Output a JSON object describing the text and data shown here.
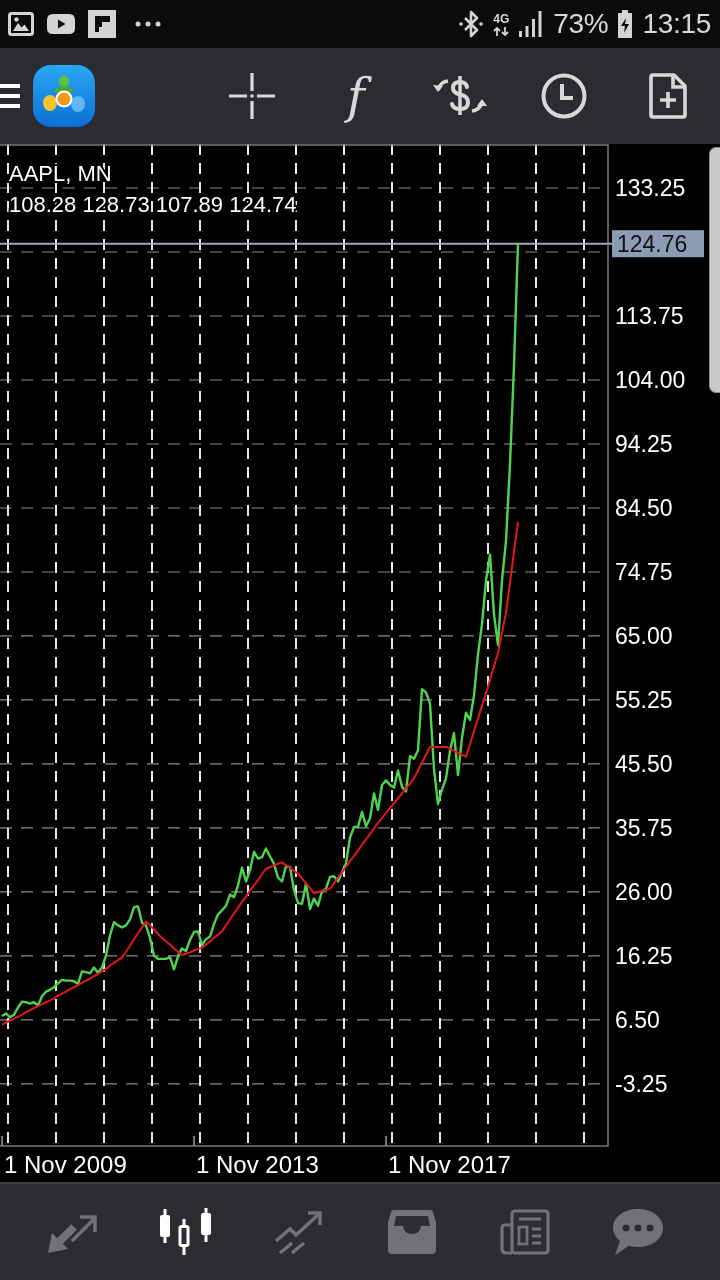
{
  "status_bar": {
    "network": "4G",
    "battery": "73%",
    "time": "13:15"
  },
  "toolbar": {
    "function_label": "f"
  },
  "chart": {
    "ohlc": "108.28 128.73 107.89 124.74",
    "time_labels": [
      "1 Nov 2009",
      "1 Nov 2013",
      "1 Nov 2017"
    ],
    "chart_data": {
      "type": "line",
      "title": "AAPL, MN",
      "grid": true,
      "ylim": [
        -12.7,
        139.95
      ],
      "yticks": [
        {
          "value": 133.25,
          "label": "133.25"
        },
        {
          "value": 113.75,
          "label": "113.75"
        },
        {
          "value": 104,
          "label": "104.00"
        },
        {
          "value": 94.25,
          "label": "94.25"
        },
        {
          "value": 84.5,
          "label": "84.50"
        },
        {
          "value": 74.75,
          "label": "74.75"
        },
        {
          "value": 65,
          "label": "65.00"
        },
        {
          "value": 55.25,
          "label": "55.25"
        },
        {
          "value": 45.5,
          "label": "45.50"
        },
        {
          "value": 35.75,
          "label": "35.75"
        },
        {
          "value": 26,
          "label": "26.00"
        },
        {
          "value": 16.25,
          "label": "16.25"
        },
        {
          "value": 6.5,
          "label": "6.50"
        },
        {
          "value": -3.25,
          "label": "-3.25"
        }
      ],
      "series": [
        {
          "color": "#4fd44f",
          "values": [
            7.1,
            7.5,
            6.9,
            7.3,
            8.4,
            9.3,
            9.2,
            9.0,
            9.2,
            8.7,
            10.1,
            10.8,
            11.1,
            11.5,
            12.1,
            12.6,
            12.5,
            12.5,
            12.4,
            12.0,
            13.9,
            13.8,
            13.6,
            14.5,
            13.7,
            14.5,
            16.3,
            19.4,
            21.4,
            20.9,
            20.6,
            20.9,
            21.8,
            23.7,
            23.8,
            21.3,
            20.9,
            19.0,
            16.3,
            15.8,
            15.8,
            15.8,
            16.1,
            14.2,
            16.2,
            17.4,
            17.0,
            18.7,
            19.9,
            20.0,
            17.9,
            18.8,
            19.2,
            21.1,
            22.6,
            23.2,
            23.9,
            25.6,
            25.2,
            27.0,
            29.7,
            27.6,
            29.3,
            32.1,
            31.1,
            31.3,
            32.6,
            31.4,
            30.3,
            28.2,
            27.6,
            29.9,
            29.8,
            26.3,
            24.3,
            24.2,
            27.3,
            23.4,
            25.0,
            23.9,
            26.1,
            26.5,
            28.3,
            28.4,
            27.6,
            29.0,
            30.3,
            34.3,
            35.9,
            35.9,
            38.2,
            36.0,
            37.2,
            41.0,
            38.5,
            42.3,
            43.0,
            42.3,
            41.9,
            44.5,
            42.0,
            41.3,
            46.7,
            46.3,
            47.6,
            56.9,
            56.4,
            54.7,
            44.7,
            39.4,
            41.6,
            43.3,
            47.5,
            50.2,
            43.8,
            49.5,
            53.3,
            52.2,
            56.0,
            62.2,
            66.8,
            73.4,
            77.4,
            68.3,
            63.6,
            73.5,
            79.5,
            91.2,
            106.3,
            124.7,
            null,
            null,
            null,
            null,
            null,
            null,
            null,
            null,
            null,
            null,
            null,
            null,
            null,
            null,
            null,
            null,
            null,
            null,
            null,
            null,
            null,
            null
          ]
        },
        {
          "color": "#e3151d",
          "values": [
            5.8,
            6.1,
            6.4,
            6.7,
            7.0,
            7.3,
            7.7,
            8.0,
            8.3,
            8.6,
            8.9,
            9.2,
            9.5,
            9.8,
            10.2,
            10.5,
            10.8,
            11.2,
            11.5,
            11.8,
            12.2,
            12.5,
            12.8,
            13.2,
            13.5,
            13.9,
            14.3,
            14.8,
            15.2,
            15.6,
            16.0,
            16.9,
            17.8,
            18.8,
            19.7,
            20.6,
            21.5,
            20.9,
            20.3,
            19.6,
            19.0,
            18.5,
            18.0,
            17.4,
            16.9,
            16.4,
            16.6,
            16.8,
            17.1,
            17.3,
            17.5,
            18.0,
            18.5,
            19.0,
            19.5,
            20.0,
            20.9,
            21.8,
            22.7,
            23.6,
            24.5,
            25.3,
            26.2,
            27.0,
            27.8,
            28.7,
            29.5,
            29.8,
            30.0,
            30.3,
            30.5,
            30.1,
            29.7,
            29.2,
            28.8,
            28.1,
            27.3,
            26.6,
            25.8,
            26.0,
            26.2,
            26.3,
            26.5,
            27.3,
            28.2,
            29.0,
            29.8,
            30.7,
            31.5,
            32.3,
            33.2,
            34.0,
            34.8,
            35.7,
            36.5,
            37.3,
            38.0,
            38.8,
            39.5,
            40.3,
            41.0,
            41.8,
            42.5,
            43.3,
            44.5,
            45.7,
            46.9,
            48.1,
            48.1,
            48.1,
            48.1,
            48.1,
            47.8,
            47.5,
            47.2,
            46.9,
            46.6,
            48.5,
            50.5,
            52.4,
            54.4,
            56.3,
            58.3,
            60.4,
            62.4,
            65.5,
            68.5,
            73.1,
            77.8,
            82.4,
            null,
            null,
            null,
            null,
            null,
            null,
            null,
            null,
            null,
            null,
            null,
            null,
            null,
            null,
            null,
            null,
            null,
            null,
            null,
            null,
            null,
            null
          ]
        }
      ],
      "ref_lines": [
        {
          "axis": "y",
          "value": 124.76,
          "label": "124.76"
        }
      ]
    }
  },
  "bottom_nav": [
    {
      "kind": "arrows",
      "selected": false
    },
    {
      "kind": "candles",
      "selected": true
    },
    {
      "kind": "trend",
      "selected": false
    },
    {
      "kind": "tray",
      "selected": false
    },
    {
      "kind": "newspaper",
      "selected": false
    },
    {
      "kind": "chat",
      "selected": false
    }
  ]
}
